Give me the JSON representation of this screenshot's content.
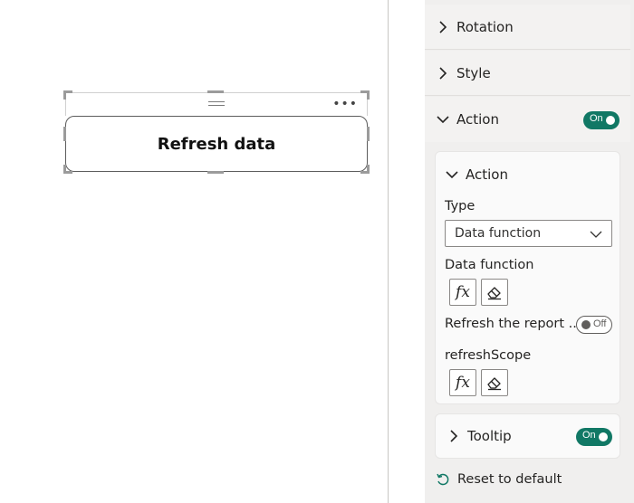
{
  "canvas": {
    "button_visual": {
      "label": "Refresh data"
    }
  },
  "pane": {
    "sections": {
      "rotation": "Rotation",
      "style": "Style",
      "action": "Action",
      "tooltip": "Tooltip"
    },
    "action_toggle": "On",
    "tooltip_toggle": "On",
    "action_card": {
      "title": "Action",
      "type_label": "Type",
      "type_value": "Data function",
      "data_function_label": "Data function",
      "refresh_label": "Refresh the report ...",
      "refresh_toggle": "Off",
      "refresh_scope_label": "refreshScope"
    },
    "reset_label": "Reset to default"
  },
  "icons": {
    "fx": "fx",
    "eraser": "eraser-icon",
    "chevron": "chevron-icon",
    "reset": "reset-icon"
  },
  "colors": {
    "accent_toggle": "#117865",
    "pane_bg": "#f0efee"
  }
}
